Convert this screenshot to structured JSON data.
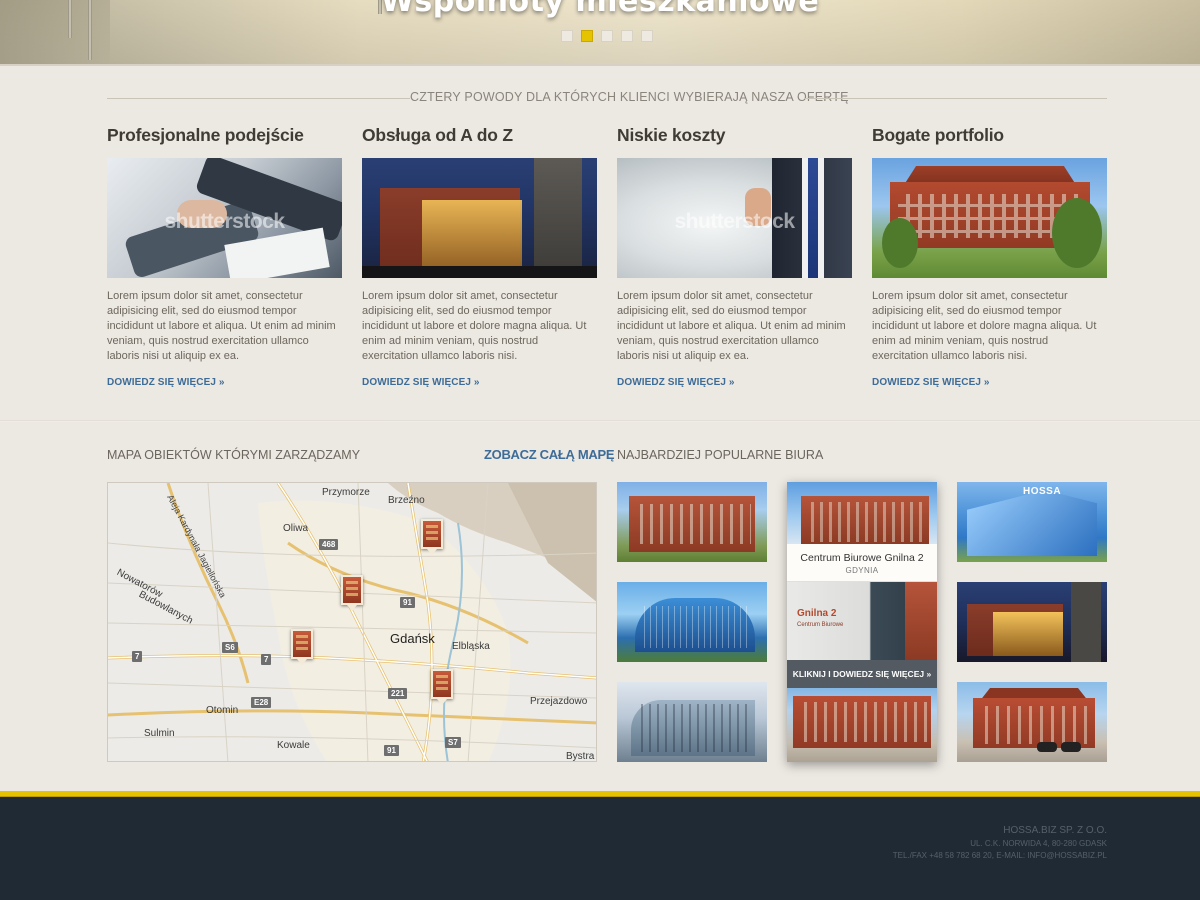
{
  "hero": {
    "title": "Wspólnoty mieszkaniowe",
    "slides": 5,
    "active_slide": 2
  },
  "reasons": {
    "heading": "CZTERY POWODY DLA KTÓRYCH KLIENCI WYBIERAJĄ NASZA OFERTĘ",
    "items": [
      {
        "title": "Profesjonalne podejście",
        "image": "handshake-photo",
        "watermark": "shutterstock",
        "text": "Lorem ipsum dolor sit amet, consectetur adipisicing elit, sed do eiusmod tempor incididunt ut labore et aliqua. Ut enim ad minim veniam, quis nostrud exercitation ullamco laboris nisi ut aliquip ex ea.",
        "link": "DOWIEDZ SIĘ WIĘCEJ »"
      },
      {
        "title": "Obsługa od A do Z",
        "image": "shopping-mall-photo",
        "text": "Lorem ipsum dolor sit amet, consectetur adipisicing elit, sed do eiusmod tempor incididunt ut labore et dolore magna aliqua. Ut enim ad minim veniam, quis nostrud exercitation ullamco laboris nisi.",
        "link": "DOWIEDZ SIĘ WIĘCEJ »"
      },
      {
        "title": "Niskie koszty",
        "image": "businessman-thumbs-up-photo",
        "watermark": "shutterstock",
        "text": "Lorem ipsum dolor sit amet, consectetur adipisicing elit, sed do eiusmod tempor incididunt ut labore et aliqua. Ut enim ad minim veniam, quis nostrud exercitation ullamco laboris nisi ut aliquip ex ea.",
        "link": "DOWIEDZ SIĘ WIĘCEJ »"
      },
      {
        "title": "Bogate portfolio",
        "image": "red-brick-building-photo",
        "text": "Lorem ipsum dolor sit amet, consectetur adipisicing elit, sed do eiusmod tempor incididunt ut labore et dolore magna aliqua. Ut enim ad minim veniam, quis nostrud exercitation ullamco laboris nisi.",
        "link": "DOWIEDZ SIĘ WIĘCEJ »"
      }
    ]
  },
  "map_section": {
    "title": "MAPA OBIEKTÓW KTÓRYMI ZARZĄDZAMY",
    "link": "ZOBACZ CAŁĄ MAPĘ",
    "labels": {
      "street": "Aleja Kardynała Jagiellońska",
      "oliwa": "Oliwa",
      "przymorze": "Przymorze",
      "brzezno": "Brzeźno",
      "nowatorow": "Nowatorów",
      "budowlanych": "Budowlanych",
      "gdansk": "Gdańsk",
      "elblaska": "Elbląska",
      "otomin": "Otomin",
      "sulmin": "Sulmin",
      "kowale": "Kowale",
      "przejazdowo": "Przejazdowo",
      "bystra": "Bystra"
    },
    "roads": {
      "r468": "468",
      "r91a": "91",
      "r91b": "91",
      "s6": "S6",
      "r7a": "7",
      "r7b": "7",
      "e28": "E28",
      "r221": "221",
      "s7": "S7"
    }
  },
  "popular": {
    "title": "NAJBARDZIEJ POPULARNE BIURA",
    "featured": {
      "name": "Centrum Biurowe Gnilna 2",
      "city": "GDYNIA",
      "sign": "Gnilna 2",
      "sign_sub": "Centrum Biurowe",
      "cta": "KLIKNIJ I DOWIEDZ SIĘ WIĘCEJ »"
    },
    "hossa_logo": "HOSSA"
  },
  "footer": {
    "company": "HOSSA.BIZ SP. Z O.O.",
    "address": "UL. C.K. NORWIDA 4, 80-280 GDASK",
    "contact": "TEL./FAX +48 58 782 68 20, E-MAIL: INFO@HOSSABIZ.PL"
  },
  "colors": {
    "accent_yellow": "#e6c300",
    "link_blue": "#3d6c98",
    "footer_bg": "#1f2a35",
    "page_bg": "#ece8e2"
  }
}
